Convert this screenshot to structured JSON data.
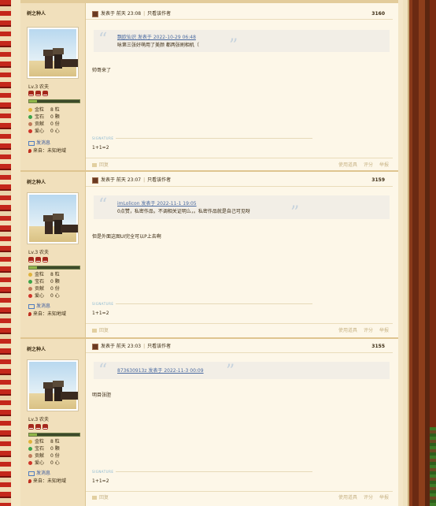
{
  "posts": [
    {
      "username": "树之种人",
      "level": "Lv.3 农夫",
      "stats": [
        {
          "icon": "gold-coin-icon",
          "color": "#e0b33c",
          "label": "金粒",
          "value": "8 粒"
        },
        {
          "icon": "gem-icon",
          "color": "#3ca44a",
          "label": "宝石",
          "value": "0 颗"
        },
        {
          "icon": "contribution-icon",
          "color": "#c07a5a",
          "label": "贡献",
          "value": "0 份"
        },
        {
          "icon": "heart-icon",
          "color": "#d0342a",
          "label": "爱心",
          "value": "0 心"
        }
      ],
      "send_message": "发消息",
      "location": "来自：未知地域",
      "posted": "发表于 前天 23:08",
      "only_author": "只看该作者",
      "floor": "3160",
      "quote_line1": "飘欧仙识 发表于 2022-10-29 06:48",
      "quote_line2": "咏第三张好萌用了美颜 都两张刷相机（",
      "body": "帅哥来了",
      "signature_label": "SIGNATURE",
      "signature": "1+1=2",
      "reply": "回复",
      "report": "使用道具",
      "rate": "评分",
      "flag": "举报"
    },
    {
      "username": "树之种人",
      "level": "Lv.3 农夫",
      "stats": [
        {
          "icon": "gold-coin-icon",
          "color": "#e0b33c",
          "label": "金粒",
          "value": "8 粒"
        },
        {
          "icon": "gem-icon",
          "color": "#3ca44a",
          "label": "宝石",
          "value": "0 颗"
        },
        {
          "icon": "contribution-icon",
          "color": "#c07a5a",
          "label": "贡献",
          "value": "0 份"
        },
        {
          "icon": "heart-icon",
          "color": "#d0342a",
          "label": "爱心",
          "value": "0 心"
        }
      ],
      "send_message": "发消息",
      "location": "来自：未知地域",
      "posted": "发表于 前天 23:07",
      "only_author": "只看该作者",
      "floor": "3159",
      "quote_line1": "imLolicon 发表于 2022-11-1 19:05",
      "quote_line2": "0点赞，私密作品，不调相关证明么，。私密作品就是自己可见呀",
      "body": "但是外面这图UI完全可以P上去啊",
      "signature_label": "SIGNATURE",
      "signature": "1+1=2",
      "reply": "回复",
      "report": "使用道具",
      "rate": "评分",
      "flag": "举报"
    },
    {
      "username": "树之种人",
      "level": "Lv.3 农夫",
      "stats": [
        {
          "icon": "gold-coin-icon",
          "color": "#e0b33c",
          "label": "金粒",
          "value": "8 粒"
        },
        {
          "icon": "gem-icon",
          "color": "#3ca44a",
          "label": "宝石",
          "value": "0 颗"
        },
        {
          "icon": "contribution-icon",
          "color": "#c07a5a",
          "label": "贡献",
          "value": "0 份"
        },
        {
          "icon": "heart-icon",
          "color": "#d0342a",
          "label": "爱心",
          "value": "0 心"
        }
      ],
      "send_message": "发消息",
      "location": "来自：未知地域",
      "posted": "发表于 前天 23:03",
      "only_author": "只看该作者",
      "floor": "3155",
      "quote_line1": "873630913z 发表于 2022-11-3 00:09",
      "quote_line2": "",
      "body": "明目张胆",
      "signature_label": "SIGNATURE",
      "signature": "1+1=2",
      "reply": "回复",
      "report": "使用道具",
      "rate": "评分",
      "flag": "举报"
    }
  ]
}
